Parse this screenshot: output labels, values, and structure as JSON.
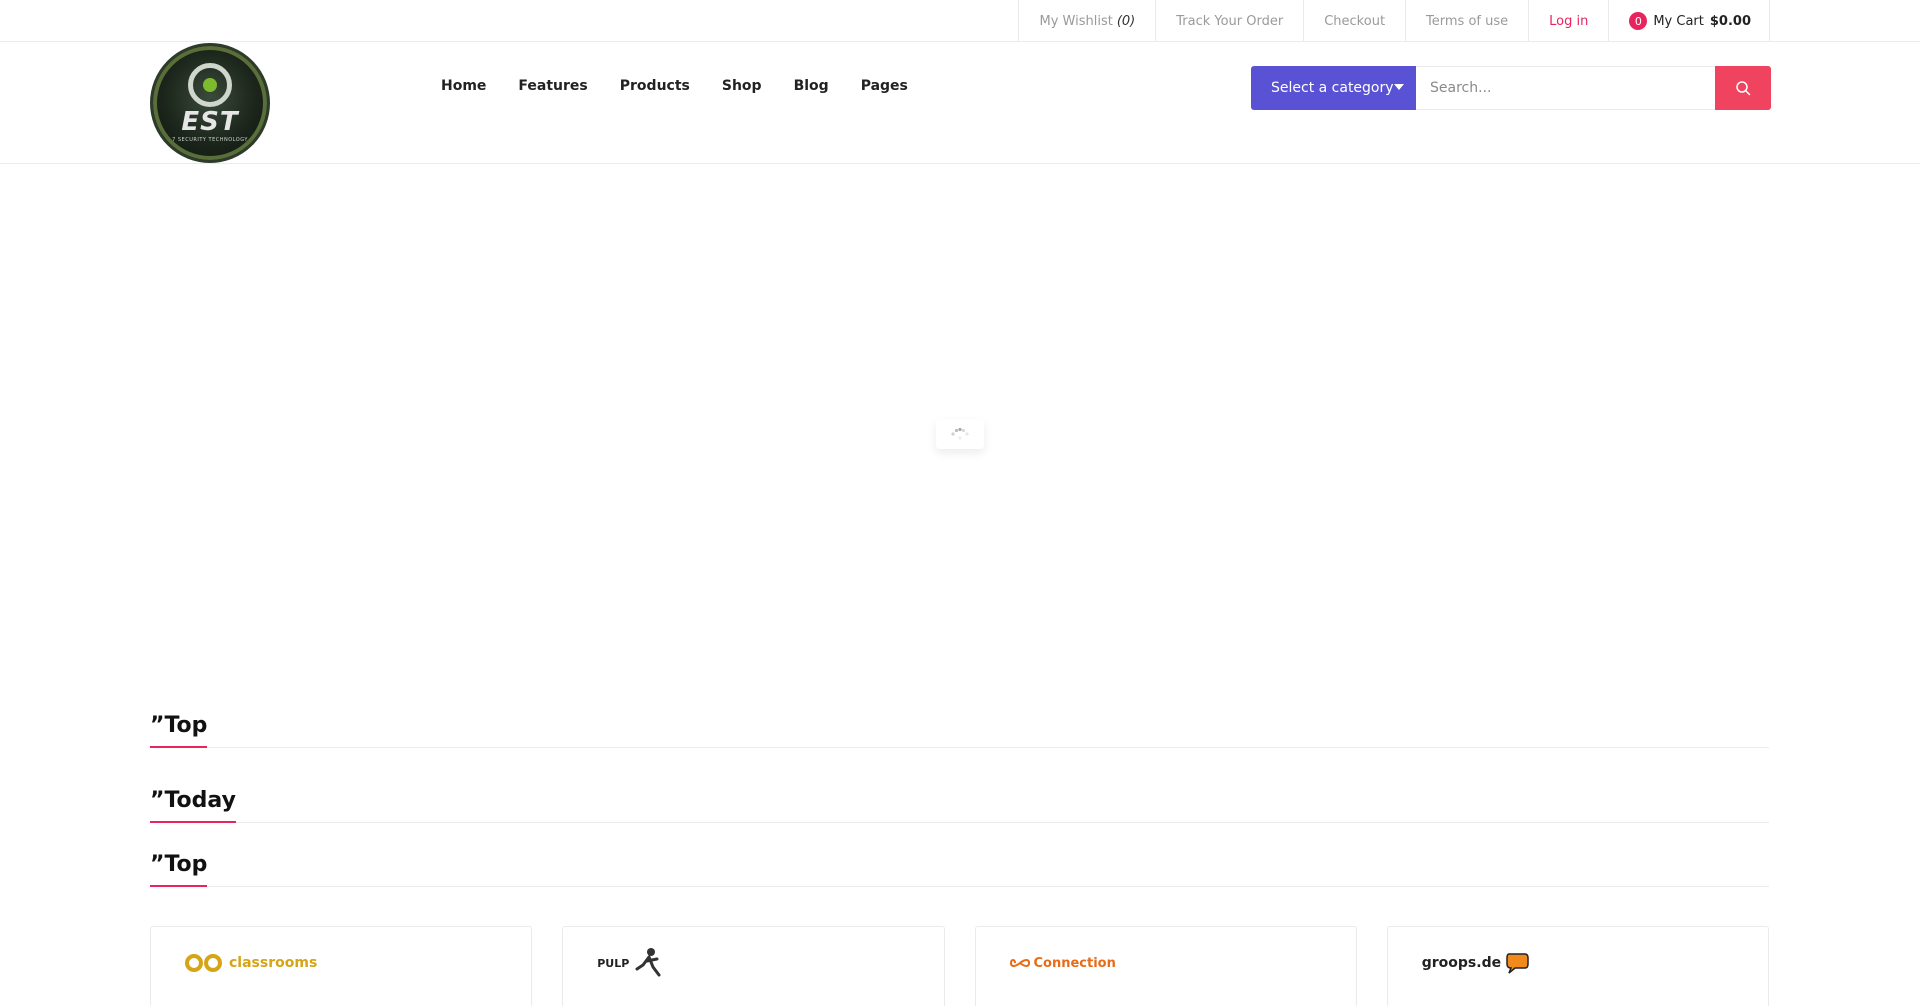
{
  "topbar": {
    "wishlist_label": "My Wishlist",
    "wishlist_count": "(0)",
    "track_order": "Track Your Order",
    "checkout": "Checkout",
    "terms": "Terms of use",
    "login": "Log in",
    "cart_count": "0",
    "cart_label": "My Cart",
    "cart_total": "$0.00"
  },
  "logo": {
    "text": "EST",
    "subtext": "7 SECURITY TECHNOLOGY"
  },
  "nav": {
    "items": [
      {
        "label": "Home"
      },
      {
        "label": "Features"
      },
      {
        "label": "Products"
      },
      {
        "label": "Shop"
      },
      {
        "label": "Blog"
      },
      {
        "label": "Pages"
      }
    ]
  },
  "search": {
    "category_label": "Select a category",
    "placeholder": "Search..."
  },
  "sections": [
    {
      "title": "”Top"
    },
    {
      "title": "”Today"
    },
    {
      "title": "”Top"
    }
  ],
  "brands": [
    {
      "name": "classrooms"
    },
    {
      "name": "PULP"
    },
    {
      "name": "Connection"
    },
    {
      "name": "groops.de"
    }
  ],
  "colors": {
    "accent": "#e8245f",
    "category_bg": "#5a52d5",
    "search_btn": "#f0435f"
  }
}
